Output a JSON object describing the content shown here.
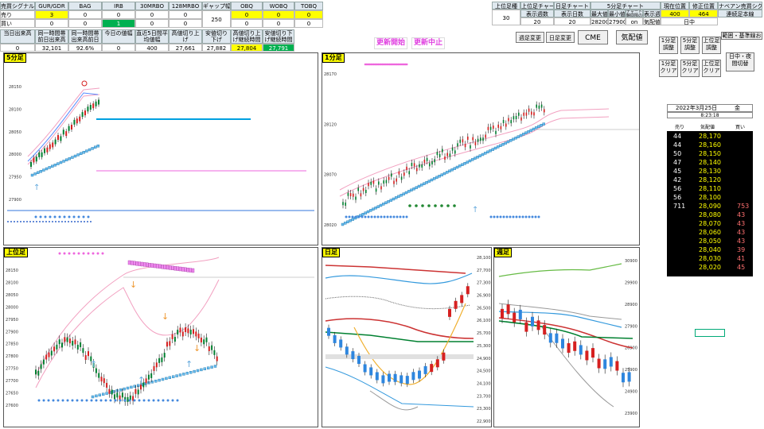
{
  "top_table": {
    "headers": [
      "売買シグナル",
      "GUR/GDR",
      "BAG",
      "IRB",
      "30MRBO",
      "128MRBO",
      "ギャップ幅",
      "OBQ",
      "WOBQ",
      "TOBQ"
    ],
    "row_sell": {
      "label": "売り",
      "values": [
        "3",
        "0",
        "0",
        "0",
        "0",
        "250",
        "0",
        "0",
        "0"
      ]
    },
    "row_buy": {
      "label": "買い",
      "values": [
        "0",
        "0",
        "1",
        "0",
        "0",
        "",
        "0",
        "0",
        "0"
      ]
    },
    "headers2": [
      "当日出来高",
      "同一時間帯前日出来高",
      "同一時間帯出来高前日比",
      "今日の値幅",
      "直近5日間平均値幅",
      "高値切り上げ",
      "安値切り下げ",
      "高値切り上げ継続時間",
      "安値切り下げ継続時間"
    ],
    "values2": [
      "0",
      "32,101",
      "92.6%",
      "0",
      "400",
      "27,661",
      "27,882",
      "27,804",
      "27,791"
    ]
  },
  "right_table": {
    "headers": [
      "上位足種",
      "上位足チャート",
      "日足チャート",
      "5分足チャート",
      "",
      "",
      "現在位置",
      "修正位置",
      "ナベアン売買シグ"
    ],
    "sub_headers": [
      "表示週数",
      "表示日数",
      "最大値",
      "最小値",
      "チャート軸間隔の単位",
      "表示週数"
    ],
    "values": [
      "30",
      "20",
      "20",
      "28200",
      "27900",
      "on",
      "気配値"
    ],
    "current_pos": "400",
    "fixed_pos": "464",
    "session": "日中",
    "signal_label": "連続足本線"
  },
  "buttons": {
    "start": "更新開始",
    "stop": "更新中止",
    "week_change": "週足変更",
    "day_change": "日足変更",
    "cme": "CME",
    "quote": "気配値",
    "adj1": "1分足調整",
    "adj5": "5分足調整",
    "adj_upper": "上位足調整",
    "clear1": "1分足クリア",
    "clear5": "5分足クリア",
    "clear_upper": "上位足クリア",
    "session_switch": "日中・夜間切替",
    "range_reset": "範囲・基準線お"
  },
  "panels": {
    "p5min": "5分足",
    "p1min": "1分足",
    "pupper": "上位足",
    "pdaily": "日足",
    "pweekly": "週足"
  },
  "board": {
    "date": "2022年3月25日",
    "weekday": "金",
    "time": "8:23:18",
    "headers": [
      "売り",
      "気配値",
      "買い"
    ],
    "rows": [
      {
        "sell": "44",
        "price": "28,170",
        "buy": ""
      },
      {
        "sell": "44",
        "price": "28,160",
        "buy": ""
      },
      {
        "sell": "50",
        "price": "28,150",
        "buy": ""
      },
      {
        "sell": "47",
        "price": "28,140",
        "buy": ""
      },
      {
        "sell": "45",
        "price": "28,130",
        "buy": ""
      },
      {
        "sell": "42",
        "price": "28,120",
        "buy": ""
      },
      {
        "sell": "56",
        "price": "28,110",
        "buy": ""
      },
      {
        "sell": "56",
        "price": "28,100",
        "buy": ""
      },
      {
        "sell": "711",
        "price": "28,090",
        "buy": "753"
      },
      {
        "sell": "",
        "price": "28,080",
        "buy": "43"
      },
      {
        "sell": "",
        "price": "28,070",
        "buy": "43"
      },
      {
        "sell": "",
        "price": "28,060",
        "buy": "43"
      },
      {
        "sell": "",
        "price": "28,050",
        "buy": "43"
      },
      {
        "sell": "",
        "price": "28,040",
        "buy": "39"
      },
      {
        "sell": "",
        "price": "28,030",
        "buy": "41"
      },
      {
        "sell": "",
        "price": "28,020",
        "buy": "45"
      }
    ]
  },
  "axes": {
    "p5min": [
      "28150",
      "28100",
      "28050",
      "28000",
      "27950",
      "27900"
    ],
    "p1min": [
      "28170",
      "28120",
      "28070",
      "28020"
    ],
    "pupper": [
      "28150",
      "28100",
      "28050",
      "28000",
      "27950",
      "27900",
      "27850",
      "27800",
      "27750",
      "27700",
      "27650",
      "27600"
    ],
    "pdaily": [
      "28,100",
      "27,700",
      "27,300",
      "26,900",
      "26,500",
      "26,100",
      "25,700",
      "25,300",
      "24,900",
      "24,500",
      "24,100",
      "23,700",
      "23,300",
      "22,900"
    ],
    "pweekly": [
      "30900",
      "29900",
      "28900",
      "27900",
      "26900",
      "25900",
      "24900",
      "23900"
    ]
  },
  "colors": {
    "pink": "#ee66dd",
    "blue": "#3399dd",
    "cyan": "#00a0e0",
    "red": "#d62020",
    "green": "#008030",
    "yellow": "#ffff00"
  }
}
